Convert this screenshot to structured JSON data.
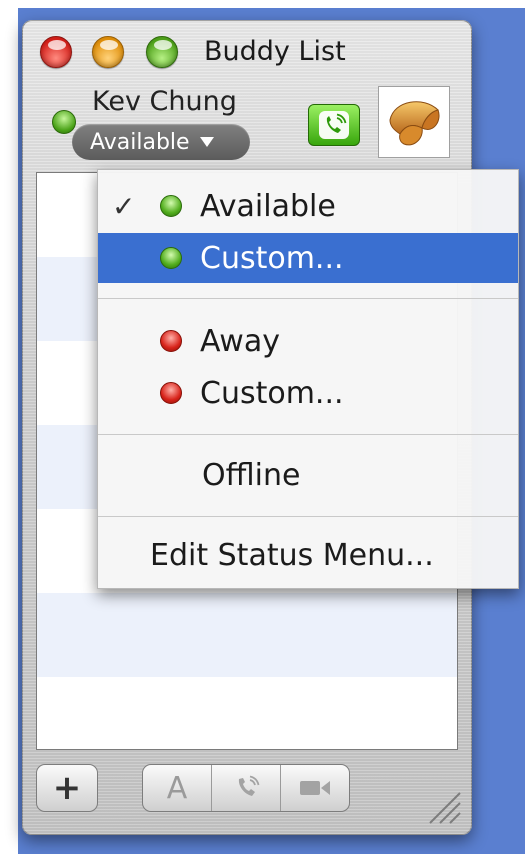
{
  "window": {
    "title": "Buddy List"
  },
  "user": {
    "name": "Kev Chung",
    "status_label": "Available"
  },
  "menu": {
    "items": [
      {
        "label": "Available",
        "checked": true,
        "dot": "green",
        "selected": false
      },
      {
        "label": "Custom...",
        "checked": false,
        "dot": "green",
        "selected": true
      },
      {
        "label": "Away",
        "checked": false,
        "dot": "red",
        "selected": false
      },
      {
        "label": "Custom...",
        "checked": false,
        "dot": "red",
        "selected": false
      },
      {
        "label": "Offline",
        "checked": false,
        "dot": "none",
        "selected": false
      },
      {
        "label": "Edit Status Menu...",
        "checked": false,
        "dot": "none",
        "selected": false
      }
    ],
    "check_glyph": "✓"
  },
  "toolbar": {
    "add_label": "+",
    "text_label": "A"
  },
  "colors": {
    "desktop": "#5a7fd0",
    "menu_highlight": "#3a6fd0",
    "status_green": "#4aa218",
    "status_red": "#d8231a"
  },
  "icons": {
    "av_button": "phone-icon",
    "buddy_icon": "fortune-cookie-icon",
    "audio": "phone-icon",
    "video": "video-camera-icon",
    "resize": "resize-grip-icon"
  }
}
